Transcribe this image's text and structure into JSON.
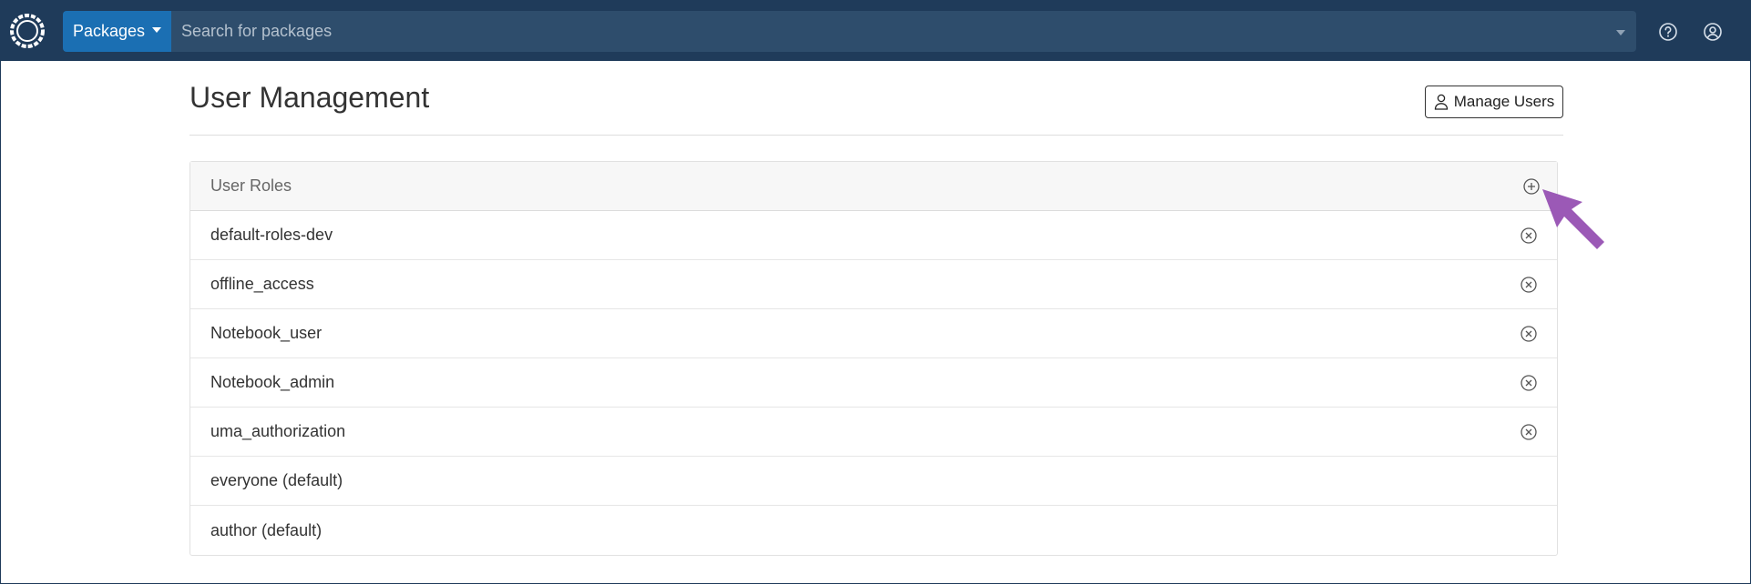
{
  "header": {
    "logo_icon": "anaconda-logo-icon",
    "packages_label": "Packages",
    "search_placeholder": "Search for packages",
    "help_icon": "help-circle-icon",
    "user_icon": "user-account-icon"
  },
  "page": {
    "title": "User Management",
    "manage_users_label": "Manage Users"
  },
  "roles_panel": {
    "header_label": "User Roles",
    "roles": [
      {
        "name": "default-roles-dev",
        "removable": true
      },
      {
        "name": "offline_access",
        "removable": true
      },
      {
        "name": "Notebook_user",
        "removable": true
      },
      {
        "name": "Notebook_admin",
        "removable": true
      },
      {
        "name": "uma_authorization",
        "removable": true
      },
      {
        "name": "everyone (default)",
        "removable": false
      },
      {
        "name": "author (default)",
        "removable": false
      }
    ]
  },
  "colors": {
    "topbar": "#1f3b5a",
    "packages_button": "#1b6fb3",
    "search_background": "#2e4d6c",
    "annotation_arrow": "#9b59b6"
  }
}
